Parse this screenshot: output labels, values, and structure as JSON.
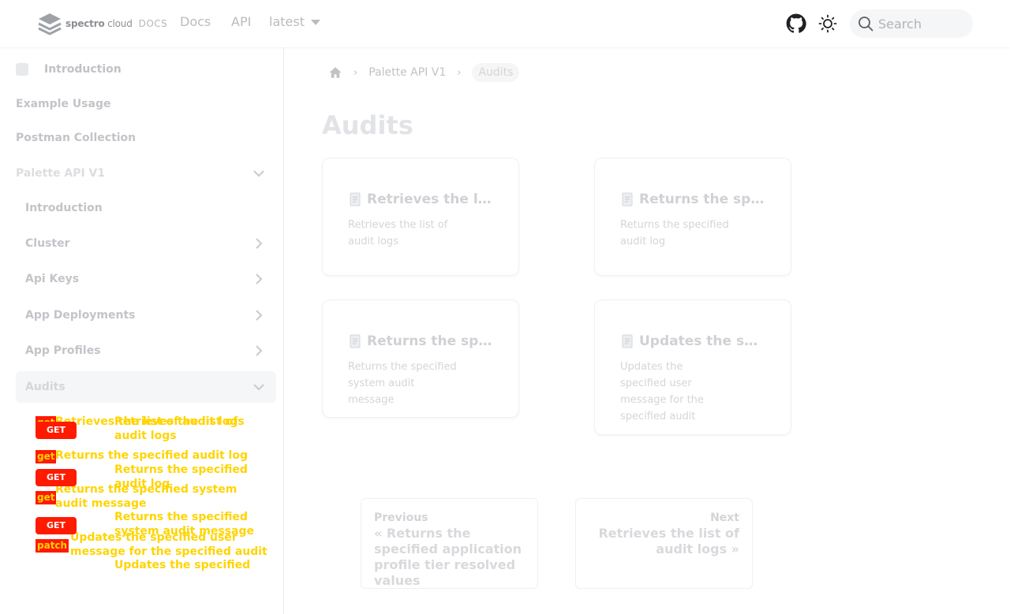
{
  "navbar": {
    "brand_main": "spectro",
    "brand_cloud": "cloud",
    "brand_suffix": "DOCS",
    "docs": "Docs",
    "api": "API",
    "version": "latest",
    "search_placeholder": "Search"
  },
  "sidebar": {
    "introduction_top": "Introduction",
    "example_usage": "Example Usage",
    "postman": "Postman Collection",
    "palette_api": "Palette API V1",
    "sub_items": {
      "introduction": "Introduction",
      "cluster": "Cluster",
      "api_keys": "Api Keys",
      "app_deployments": "App Deployments",
      "app_profiles": "App Profiles",
      "audits": "Audits"
    },
    "endpoints": [
      {
        "method": "GET",
        "label": "Retrieves the list of audit logs"
      },
      {
        "method": "GET",
        "label": "Returns the specified audit log"
      },
      {
        "method": "GET",
        "label": "Returns the specified system audit message"
      },
      {
        "method": "PATCH",
        "label": "Updates the specified user message for the specified audit"
      }
    ],
    "overlay_labels": {
      "r1_prefix": "get",
      "r1_a": "Retrieves the list of audit logs",
      "r2_prefix": "get",
      "r2_a": "Returns the specified audit log",
      "r3_prefix": "get",
      "r3_a": "Returns the specified system audit message",
      "r4_prefix": "patch",
      "r4_a": "Updates the specified user message for the specified audit",
      "u1": "Retrieves the list of audit logs",
      "u2": "Returns the specified audit log",
      "u3": "Returns the specified system audit message",
      "u4": "Updates the specified"
    }
  },
  "breadcrumb": {
    "section": "Palette API V1",
    "current": "Audits"
  },
  "main": {
    "title": "Audits",
    "cards": [
      {
        "title": "Retrieves the list o…",
        "desc": "Retrieves the list of audit logs"
      },
      {
        "title": "Returns the specif…",
        "desc": "Returns the specified audit log"
      },
      {
        "title": "Returns the specif…",
        "desc": "Returns the specified system audit message"
      },
      {
        "title": "Updates the speci…",
        "desc": "Updates the specified user message for the specified audit"
      }
    ],
    "pager": {
      "prev_label": "Previous",
      "prev_title": "« Returns the specified application profile tier resolved values",
      "next_label": "Next",
      "next_title": "Retrieves the list of audit logs »"
    }
  }
}
